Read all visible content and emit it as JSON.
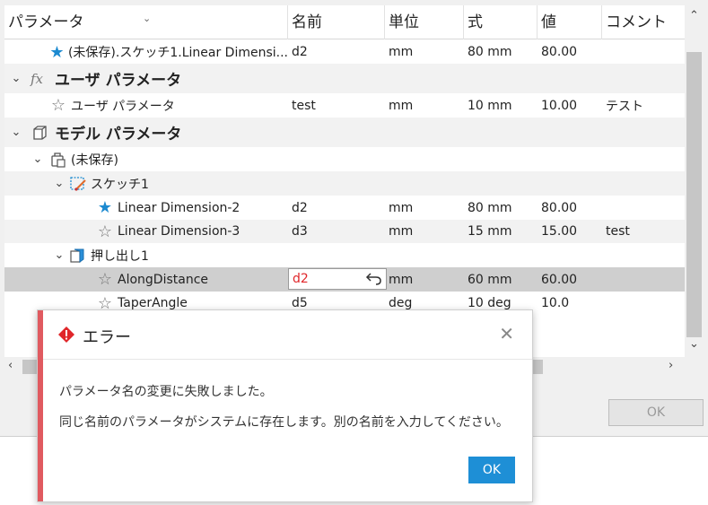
{
  "columns": [
    "パラメータ",
    "名前",
    "単位",
    "式",
    "値",
    "コメント"
  ],
  "rows": [
    {
      "kind": "param",
      "label": "(未保存).スケッチ1.Linear Dimensi...",
      "star": "filled",
      "name": "d2",
      "unit": "mm",
      "expr": "80 mm",
      "value": "80.00",
      "comment": ""
    },
    {
      "kind": "group",
      "label": "ユーザ パラメータ",
      "icon": "fx-icon"
    },
    {
      "kind": "param",
      "label": "ユーザ パラメータ",
      "star": "outline",
      "name": "test",
      "unit": "mm",
      "expr": "10 mm",
      "value": "10.00",
      "comment": "テスト"
    },
    {
      "kind": "group",
      "label": "モデル パラメータ",
      "icon": "cube-icon"
    },
    {
      "kind": "node",
      "label": "(未保存)",
      "icon": "component-icon"
    },
    {
      "kind": "node",
      "label": "スケッチ1",
      "icon": "sketch-icon"
    },
    {
      "kind": "param",
      "label": "Linear Dimension-2",
      "star": "filled",
      "name": "d2",
      "unit": "mm",
      "expr": "80 mm",
      "value": "80.00",
      "comment": ""
    },
    {
      "kind": "param",
      "label": "Linear Dimension-3",
      "star": "outline",
      "name": "d3",
      "unit": "mm",
      "expr": "15 mm",
      "value": "15.00",
      "comment": "test"
    },
    {
      "kind": "node",
      "label": "押し出し1",
      "icon": "extrude-icon"
    },
    {
      "kind": "param",
      "label": "AlongDistance",
      "star": "outline",
      "name": "d2",
      "unit": "mm",
      "expr": "60 mm",
      "value": "60.00",
      "comment": "",
      "editing": true
    },
    {
      "kind": "param",
      "label": "TaperAngle",
      "star": "outline",
      "name": "d5",
      "unit": "deg",
      "expr": "10 deg",
      "value": "10.0",
      "comment": ""
    }
  ],
  "background_ok_label": "OK",
  "dialog": {
    "title": "エラー",
    "message1": "パラメータ名の変更に失敗しました。",
    "message2": "同じ名前のパラメータがシステムに存在します。別の名前を入力してください。",
    "ok_label": "OK"
  },
  "colors": {
    "accent": "#1e8fd6",
    "error": "#e05a60",
    "selected_row": "#cfcfcf",
    "invalid_text": "#e0262a"
  }
}
